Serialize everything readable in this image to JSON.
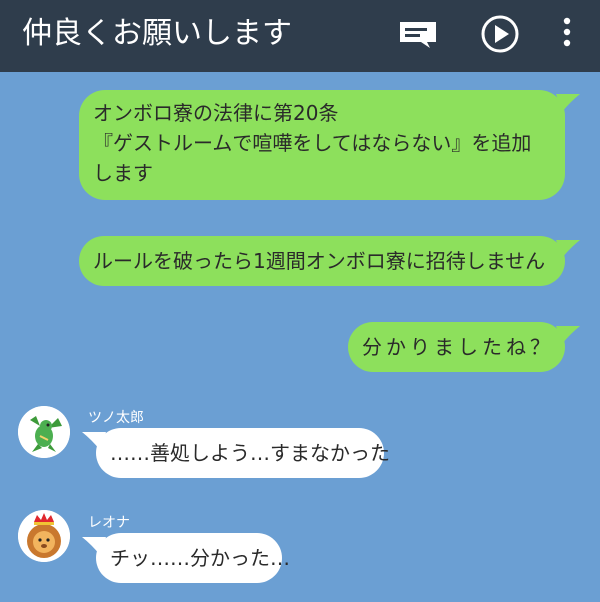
{
  "header": {
    "title": "仲良くお願いします",
    "menu_icon": "list-icon",
    "play_icon": "play-circle-icon",
    "more_icon": "more-vertical-icon",
    "background": "#2f3d4c"
  },
  "chat": {
    "background": "#6b9fd3",
    "outgoing_color": "#8de05c",
    "incoming_color": "#ffffff",
    "messages": [
      {
        "direction": "outgoing",
        "lines": [
          "オンボロ寮の法律に第20条",
          "『ゲストルームで喧嘩をしてはならない』を追加",
          "します"
        ]
      },
      {
        "direction": "outgoing",
        "lines": [
          "ルールを破ったら1週間オンボロ寮に招待しません"
        ]
      },
      {
        "direction": "outgoing",
        "lines": [
          "分かりましたね？"
        ]
      },
      {
        "direction": "incoming",
        "sender": "ツノ太郎",
        "avatar_icon": "green-dragon-icon",
        "lines": [
          "……善処しよう…すまなかった"
        ]
      },
      {
        "direction": "incoming",
        "sender": "レオナ",
        "avatar_icon": "crowned-lion-icon",
        "lines": [
          "チッ……分かった…"
        ]
      }
    ]
  }
}
